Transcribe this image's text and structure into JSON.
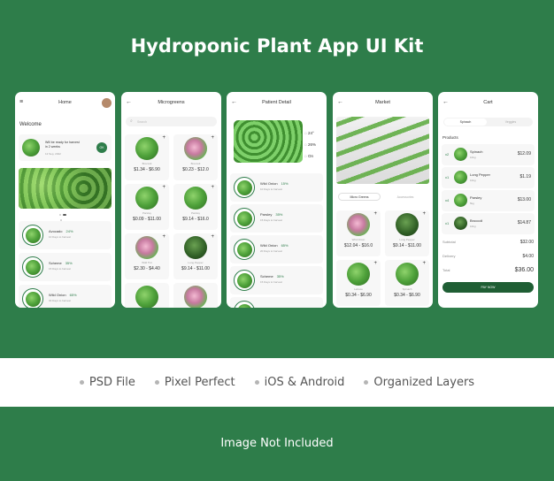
{
  "title": "Hydroponic Plant App UI Kit",
  "features": [
    "PSD File",
    "Pixel Perfect",
    "iOS & Android",
    "Organized Layers"
  ],
  "footer": "Image Not Included",
  "home": {
    "title": "Home",
    "welcome": "Welcome",
    "harvest": "Will be ready for harvest in 2 weeks",
    "harvest_date": "12 Sep, 2022",
    "ok": "OK",
    "items": [
      {
        "name": "Avocado",
        "pct": "24%",
        "sub": "10 Days to harvest"
      },
      {
        "name": "Scheme",
        "pct": "35%",
        "sub": "15 Days to harvest"
      },
      {
        "name": "Wild Onion",
        "pct": "65%",
        "sub": "30 Days to harvest"
      }
    ]
  },
  "micro": {
    "title": "Microgreens",
    "search_placeholder": "Search",
    "items": [
      {
        "name": "Broccoli",
        "price": "$1.34 - $6.90"
      },
      {
        "name": "Broccoli",
        "price": "$0.23 - $12.0"
      },
      {
        "name": "Parsley",
        "price": "$0.09 - $11.00"
      },
      {
        "name": "Parsley",
        "price": "$9.14 - $16.0"
      },
      {
        "name": "Wild Tint",
        "price": "$2.30 - $4.40"
      },
      {
        "name": "Long Pepper",
        "price": "$9.14 - $11.00"
      }
    ]
  },
  "detail": {
    "title": "Patient Detail",
    "stats": [
      "24°",
      "26%",
      "On"
    ],
    "items": [
      {
        "name": "Wild Onion",
        "pct": "15%",
        "sub": "10 Days to harvest"
      },
      {
        "name": "Parsley",
        "pct": "35%",
        "sub": "15 Days to harvest"
      },
      {
        "name": "Wild Onion",
        "pct": "65%",
        "sub": "20 Days to harvest"
      },
      {
        "name": "Scheme",
        "pct": "35%",
        "sub": "15 Days to harvest"
      }
    ]
  },
  "market": {
    "title": "Market",
    "tabs": [
      "Micro Greens",
      "Accessories"
    ],
    "items": [
      {
        "name": "Wild Onion",
        "price": "$12.04 - $16.0"
      },
      {
        "name": "Long Pepper",
        "price": "$9.14 - $11.00"
      },
      {
        "name": "Lettuce",
        "price": "$0.34 - $6.90"
      },
      {
        "name": "Spinach",
        "price": "$0.34 - $6.90"
      }
    ]
  },
  "cart": {
    "title": "Cart",
    "tabs": [
      "Spinach",
      "Veggies"
    ],
    "products_label": "Products",
    "items": [
      {
        "qty": "x2",
        "name": "Spinach",
        "sub": "10kg",
        "price": "$12.09"
      },
      {
        "qty": "x1",
        "name": "Long Pepper",
        "sub": "10kg",
        "price": "$1.19"
      },
      {
        "qty": "x4",
        "name": "Parsley",
        "sub": "5kg",
        "price": "$13.00"
      },
      {
        "qty": "x1",
        "name": "Broccoli",
        "sub": "10kg",
        "price": "$14.87"
      }
    ],
    "subtotal_label": "Subtotal",
    "subtotal": "$32.00",
    "delivery_label": "Delivery",
    "delivery": "$4.00",
    "total_label": "Total",
    "total": "$36.00",
    "pay": "PAY NOW"
  },
  "colors": {
    "brand": "#2e7d4a",
    "background": "#2e7d4a"
  }
}
